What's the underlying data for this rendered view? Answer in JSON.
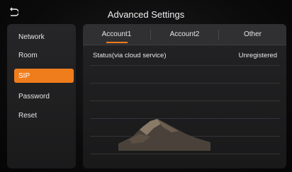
{
  "header": {
    "title": "Advanced Settings"
  },
  "sidebar": {
    "items": [
      {
        "label": "Network"
      },
      {
        "label": "Room"
      },
      {
        "label": "SIP"
      },
      {
        "label": "Password"
      },
      {
        "label": "Reset"
      }
    ],
    "active": "SIP"
  },
  "tabs": [
    {
      "label": "Account1"
    },
    {
      "label": "Account2"
    },
    {
      "label": "Other"
    }
  ],
  "status": {
    "label": "Status(via cloud service)",
    "value": "Unregistered"
  },
  "colors": {
    "accent": "#f07d1c"
  }
}
